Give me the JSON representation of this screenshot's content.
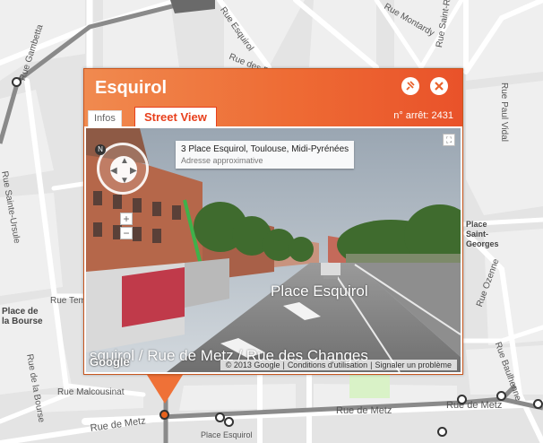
{
  "map": {
    "streets": [
      {
        "key": "esquirol_top",
        "label": "Rue Esquirol"
      },
      {
        "key": "montardy",
        "label": "Rue Montardy"
      },
      {
        "key": "gambetta",
        "label": "Rue Gambetta"
      },
      {
        "key": "saint_rome",
        "label": "Rue Saint-Rome"
      },
      {
        "key": "dessouvenirs",
        "label": "Rue des Puits Clos"
      },
      {
        "key": "sainte_ursule",
        "label": "Rue Sainte-Ursule"
      },
      {
        "key": "temponieres",
        "label": "Rue Temponières"
      },
      {
        "key": "bourse_place",
        "label": "Place de la Bourse"
      },
      {
        "key": "bourse_rue",
        "label": "Rue de la Bourse"
      },
      {
        "key": "malcousinat",
        "label": "Rue Malcousinat"
      },
      {
        "key": "metz_left",
        "label": "Rue de Metz"
      },
      {
        "key": "metz_right",
        "label": "Rue de Metz"
      },
      {
        "key": "esquirol_place",
        "label": "Place Esquirol"
      },
      {
        "key": "paul_vidal",
        "label": "Rue Paul Vidal"
      },
      {
        "key": "place_st_georges",
        "label": "Place Saint-Georges"
      },
      {
        "key": "baulhenne",
        "label": "Rue Baulhenne"
      },
      {
        "key": "ozenne",
        "label": "Rue Ozenne"
      }
    ]
  },
  "popup": {
    "title": "Esquirol",
    "tabs": {
      "infos": "Infos",
      "street_view": "Street View"
    },
    "stop_number": "n° arrêt: 2431",
    "pin_icon": "pin-icon",
    "close_icon": "close-icon"
  },
  "street_view": {
    "address": "3 Place Esquirol, Toulouse, Midi-Pyrénées",
    "address_note": "Adresse approximative",
    "road_label_1": "Place Esquirol",
    "road_label_2": "squirol / Rue de Metz / Rue des Changes",
    "google_logo": "Google",
    "footer": {
      "copyright": "© 2013 Google",
      "terms": "Conditions d'utilisation",
      "report": "Signaler un problème"
    },
    "compass_label": "N",
    "zoom_in": "+",
    "zoom_out": "−"
  },
  "colors": {
    "accent": "#ee6b34",
    "accent_dark": "#e8401d",
    "metro_line": "#7a7a7a"
  }
}
